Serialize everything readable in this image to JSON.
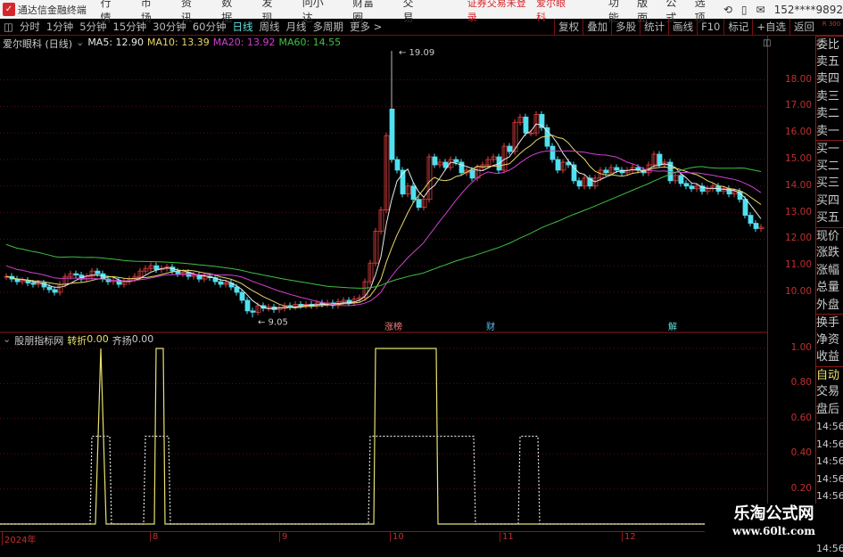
{
  "app": {
    "name": "通达信金融终端",
    "menu": [
      "行情",
      "市场",
      "资讯",
      "数据",
      "发现",
      "问小达",
      "财富圈",
      "交易"
    ],
    "warning": "证券交易未登录",
    "stock_link": "爱尔眼科",
    "right_menu": [
      "功能",
      "版面",
      "公式",
      "选项"
    ],
    "account": "152****9892"
  },
  "toolbar": {
    "periods": [
      "分时",
      "1分钟",
      "5分钟",
      "15分钟",
      "30分钟",
      "60分钟",
      "日线",
      "周线",
      "月线",
      "多周期",
      "更多 >"
    ],
    "active": "日线",
    "right": [
      "复权",
      "叠加",
      "多股",
      "统计",
      "画线",
      "F10",
      "标记",
      "+自选",
      "返回"
    ],
    "badge": "R 300"
  },
  "chart": {
    "title": "爱尔眼科 (日线)",
    "ma": [
      {
        "label": "MA5: 12.90",
        "color": "#e8e8e8"
      },
      {
        "label": "MA10: 13.39",
        "color": "#e8d66a"
      },
      {
        "label": "MA20: 13.92",
        "color": "#d040d0"
      },
      {
        "label": "MA60: 14.55",
        "color": "#40c040"
      }
    ],
    "high_label": "19.09",
    "low_label": "9.05",
    "markers": [
      "涨榜",
      "财",
      "解"
    ],
    "y_ticks": [
      "18.00",
      "17.00",
      "16.00",
      "15.00",
      "14.00",
      "13.00",
      "12.00",
      "11.00",
      "10.00"
    ]
  },
  "chart_data": {
    "type": "candlestick",
    "y_ticks": [
      18,
      17,
      16,
      15,
      14,
      13,
      12,
      11,
      10
    ],
    "high": 19.09,
    "low": 9.05,
    "closes": [
      10.6,
      10.5,
      10.4,
      10.45,
      10.35,
      10.3,
      10.35,
      10.2,
      10.1,
      10.0,
      10.3,
      10.6,
      10.7,
      10.65,
      10.5,
      10.6,
      10.8,
      10.7,
      10.5,
      10.4,
      10.45,
      10.3,
      10.4,
      10.5,
      10.6,
      10.8,
      10.9,
      11.0,
      10.85,
      10.9,
      10.95,
      10.8,
      10.7,
      10.75,
      10.6,
      10.65,
      10.5,
      10.6,
      10.55,
      10.4,
      10.3,
      10.35,
      10.2,
      10.0,
      9.7,
      9.3,
      9.25,
      9.5,
      9.4,
      9.45,
      9.35,
      9.4,
      9.5,
      9.45,
      9.55,
      9.5,
      9.55,
      9.5,
      9.6,
      9.55,
      9.6,
      9.5,
      9.65,
      9.7,
      9.6,
      9.75,
      9.8,
      10.4,
      11.1,
      12.3,
      13.1,
      15.9,
      15.0,
      14.6,
      13.7,
      14.0,
      13.5,
      13.2,
      13.5,
      15.1,
      14.8,
      14.9,
      14.7,
      15.0,
      14.9,
      14.5,
      14.6,
      14.3,
      14.7,
      14.8,
      15.0,
      15.1,
      14.6,
      15.5,
      15.3,
      16.4,
      16.6,
      16.0,
      16.0,
      16.7,
      16.2,
      15.5,
      15.0,
      14.6,
      14.9,
      14.8,
      14.2,
      14.0,
      14.3,
      14.0,
      14.3,
      14.6,
      14.5,
      14.7,
      14.6,
      14.5,
      14.6,
      14.7,
      14.6,
      14.5,
      14.8,
      15.2,
      14.8,
      14.9,
      14.2,
      14.4,
      14.1,
      14.0,
      13.9,
      14.0,
      13.8,
      13.9,
      14.0,
      13.8,
      13.9,
      13.7,
      13.8,
      13.5,
      12.9,
      12.6,
      12.4,
      12.45
    ],
    "x_labels": [
      "2024年",
      "8",
      "9",
      "10",
      "11",
      "12"
    ],
    "indicator": {
      "name": "股朋指标网",
      "series": [
        {
          "name": "转折",
          "value": "0.00",
          "color": "#e8e070",
          "pulses": [
            [
              17,
              19,
              "spike"
            ],
            [
              28,
              30,
              "flat"
            ],
            [
              69,
              81,
              "flat"
            ]
          ],
          "level": 1
        },
        {
          "name": "齐扬",
          "value": "0.00",
          "color": "#dddddd",
          "pulses": [
            [
              16,
              20
            ],
            [
              26,
              31
            ],
            [
              68,
              88
            ],
            [
              96,
              100
            ]
          ],
          "level": 0.5
        }
      ],
      "y_ticks": [
        "1.00",
        "0.80",
        "0.60",
        "0.40",
        "0.20"
      ]
    }
  },
  "side": {
    "items": [
      "委比",
      "卖五",
      "卖四",
      "卖三",
      "卖二",
      "卖一",
      "买一",
      "买二",
      "买三",
      "买四",
      "买五",
      "现价",
      "涨跌",
      "涨幅",
      "总量",
      "外盘",
      "换手",
      "净资",
      "收益",
      "自动",
      "交易",
      "盘后",
      "14:56",
      "14:56",
      "14:56",
      "14:56",
      "14:56",
      "14:56",
      "14:56",
      "14:56"
    ]
  },
  "watermark": {
    "line1": "乐淘公式网",
    "line2": "www.60lt.com"
  }
}
